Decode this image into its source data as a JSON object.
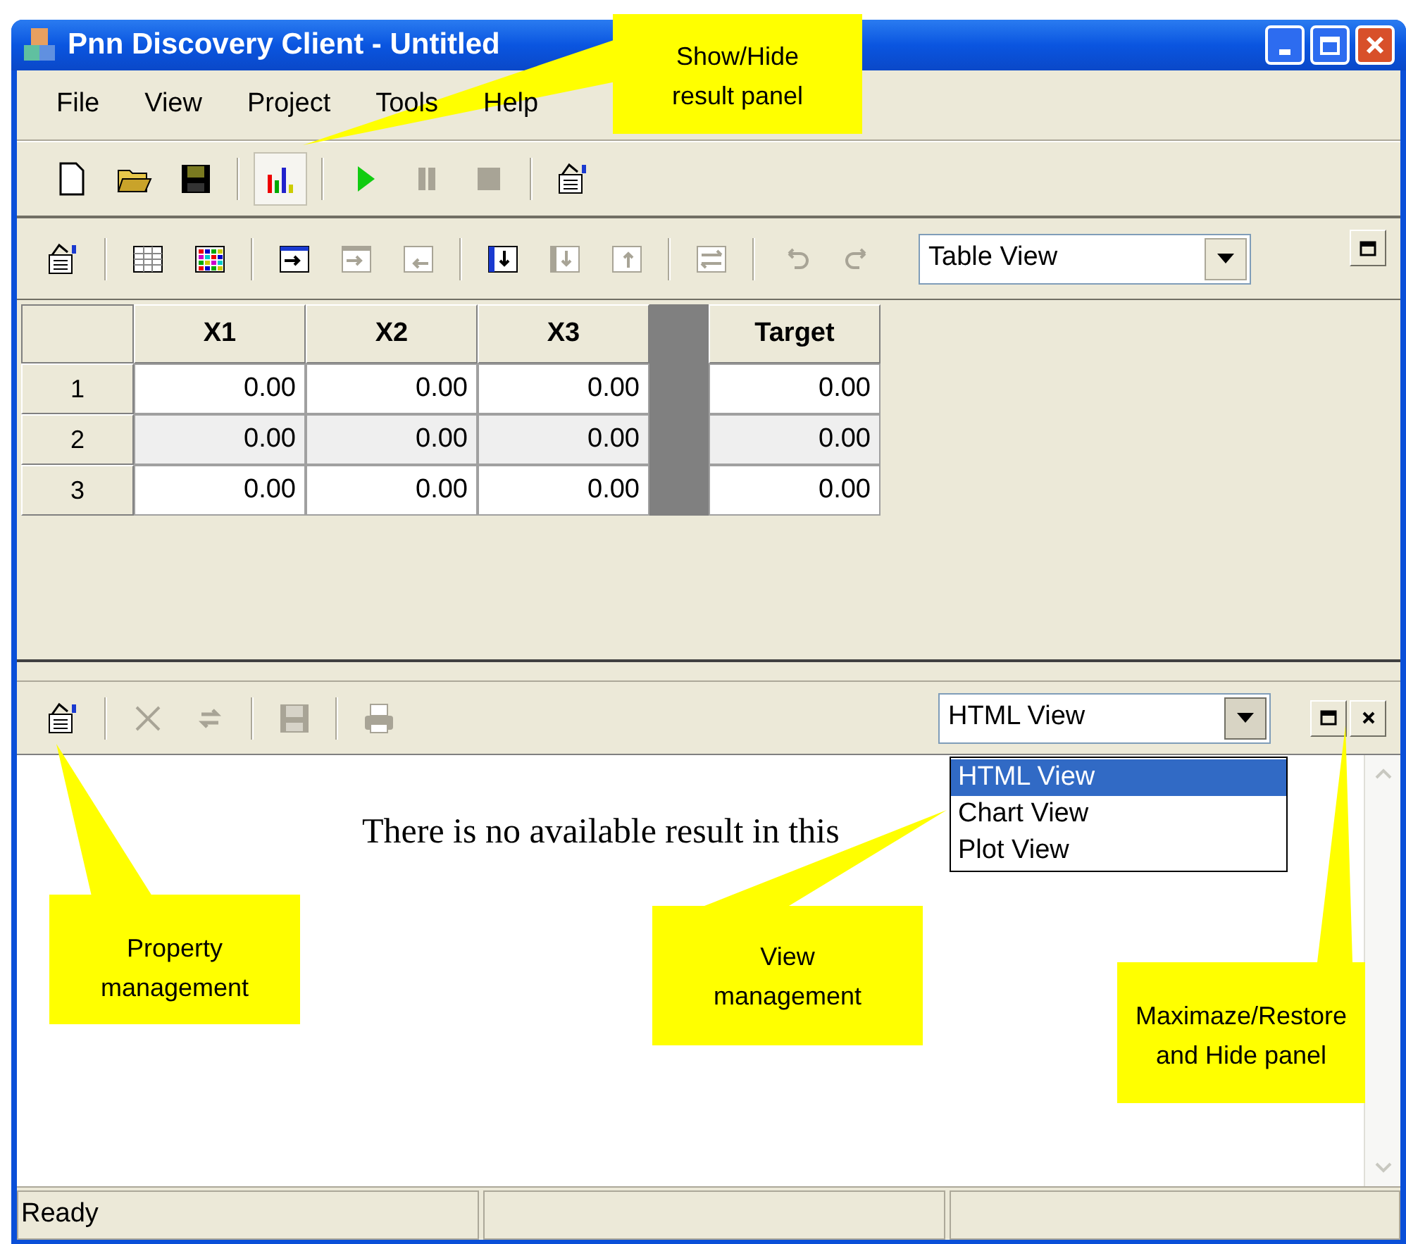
{
  "window": {
    "title": "Pnn Discovery Client - Untitled"
  },
  "menu": [
    {
      "label": "File"
    },
    {
      "label": "View"
    },
    {
      "label": "Project"
    },
    {
      "label": "Tools"
    },
    {
      "label": "Help"
    }
  ],
  "main_toolbar": [
    {
      "kind": "new",
      "disabled": false,
      "pressed": false
    },
    {
      "kind": "open",
      "disabled": false,
      "pressed": false
    },
    {
      "kind": "save",
      "disabled": false,
      "pressed": false
    },
    {
      "kind": "separator"
    },
    {
      "kind": "chart",
      "disabled": false,
      "pressed": true
    },
    {
      "kind": "separator"
    },
    {
      "kind": "run",
      "disabled": false,
      "pressed": false
    },
    {
      "kind": "pause",
      "disabled": true,
      "pressed": false
    },
    {
      "kind": "stop",
      "disabled": true,
      "pressed": false
    },
    {
      "kind": "separator"
    },
    {
      "kind": "properties",
      "disabled": false,
      "pressed": false
    }
  ],
  "data_panel": {
    "toolbar": [
      {
        "kind": "properties",
        "disabled": false
      },
      {
        "kind": "separator"
      },
      {
        "kind": "table",
        "disabled": false
      },
      {
        "kind": "color-table",
        "disabled": false
      },
      {
        "kind": "separator"
      },
      {
        "kind": "col-insert",
        "disabled": false
      },
      {
        "kind": "col-insert",
        "disabled": true
      },
      {
        "kind": "col-remove",
        "disabled": true
      },
      {
        "kind": "separator"
      },
      {
        "kind": "row-insert",
        "disabled": false
      },
      {
        "kind": "row-insert",
        "disabled": true
      },
      {
        "kind": "row-remove",
        "disabled": true
      },
      {
        "kind": "separator"
      },
      {
        "kind": "swap",
        "disabled": true
      },
      {
        "kind": "separator"
      },
      {
        "kind": "undo",
        "disabled": true
      },
      {
        "kind": "redo",
        "disabled": true
      }
    ],
    "view_select": {
      "value": "Table View"
    },
    "table": {
      "columns": [
        {
          "label": "X1",
          "kind": "input"
        },
        {
          "label": "X2",
          "kind": "input"
        },
        {
          "label": "X3",
          "kind": "input"
        },
        {
          "kind": "gap"
        },
        {
          "label": "Target",
          "kind": "input"
        }
      ],
      "rows": [
        {
          "label": "1",
          "cells": [
            "0.00",
            "0.00",
            "0.00",
            "0.00"
          ]
        },
        {
          "label": "2",
          "cells": [
            "0.00",
            "0.00",
            "0.00",
            "0.00"
          ]
        },
        {
          "label": "3",
          "cells": [
            "0.00",
            "0.00",
            "0.00",
            "0.00"
          ]
        }
      ]
    }
  },
  "result_panel": {
    "toolbar": [
      {
        "kind": "properties",
        "disabled": false
      },
      {
        "kind": "separator"
      },
      {
        "kind": "delete",
        "disabled": true
      },
      {
        "kind": "refresh",
        "disabled": true
      },
      {
        "kind": "separator"
      },
      {
        "kind": "save",
        "disabled": true
      },
      {
        "kind": "separator"
      },
      {
        "kind": "print",
        "disabled": true
      }
    ],
    "view_select": {
      "value": "HTML View",
      "expanded": true,
      "options": [
        {
          "label": "HTML View",
          "selected": true
        },
        {
          "label": "Chart View",
          "selected": false
        },
        {
          "label": "Plot View",
          "selected": false
        }
      ]
    },
    "message": "There is no available result in this"
  },
  "status_bar": {
    "text": "Ready"
  },
  "callouts": [
    {
      "lines": [
        "Show/Hide",
        "result panel"
      ]
    },
    {
      "lines": [
        "Property",
        "management"
      ]
    },
    {
      "lines": [
        "View",
        "management"
      ]
    },
    {
      "lines": [
        "Maximaze/Restore",
        "and Hide panel"
      ]
    }
  ]
}
